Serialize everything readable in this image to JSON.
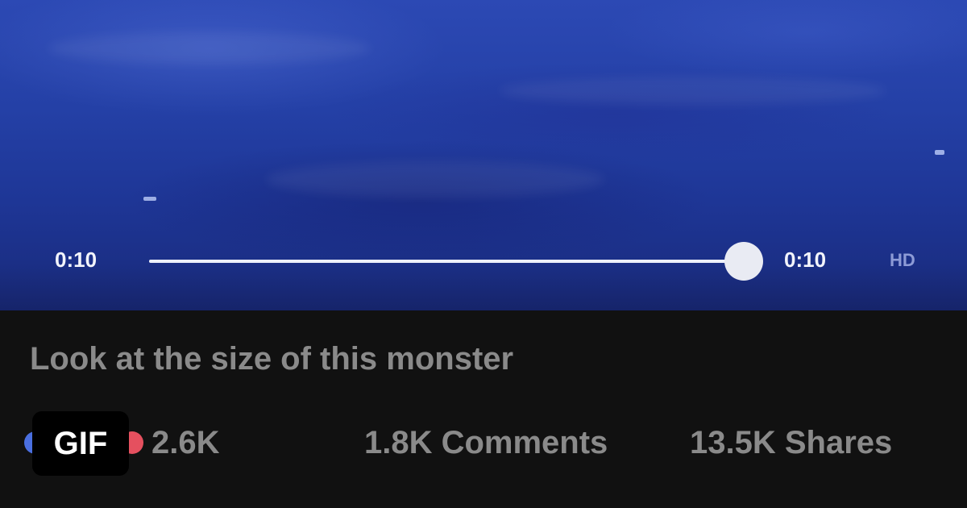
{
  "player": {
    "current_time": "0:10",
    "duration": "0:10",
    "quality": "HD",
    "progress": 0.99
  },
  "post": {
    "caption": "Look at the size of this monster",
    "reactions_count": "2.6K",
    "comments": "1.8K Comments",
    "shares": "13.5K Shares"
  },
  "badge": {
    "label": "GIF"
  },
  "colors": {
    "video_blue": "#2440a6",
    "panel_bg": "#111111",
    "muted_text": "#8a8a8a",
    "hd_text": "#8d9bd6",
    "like_blue": "#4a6fe0",
    "love_red": "#e5505f"
  },
  "icons": [
    "like-reaction-icon",
    "love-reaction-icon"
  ]
}
